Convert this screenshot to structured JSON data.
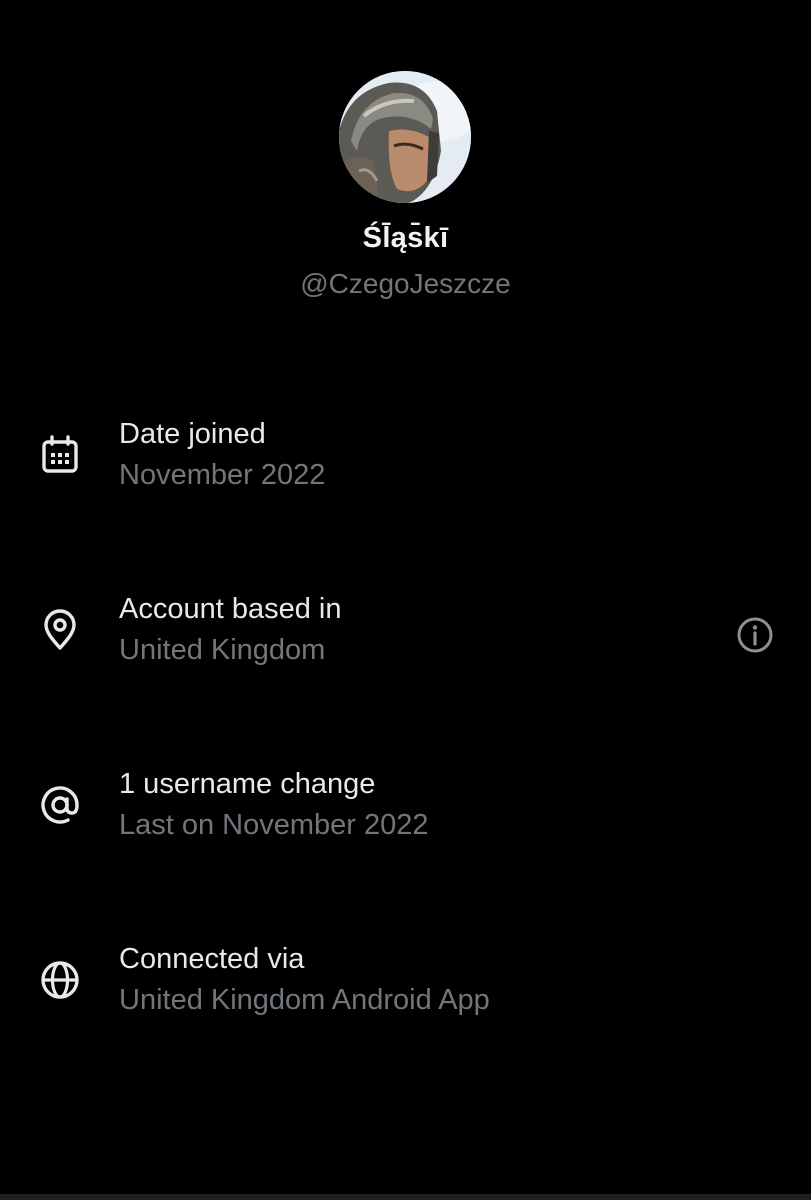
{
  "profile": {
    "display_name": "Śl̄ąs̄kī",
    "handle": "@CzegoJeszcze"
  },
  "rows": [
    {
      "icon": "calendar-icon",
      "title": "Date joined",
      "value": "November 2022"
    },
    {
      "icon": "location-pin-icon",
      "title": "Account based in",
      "value": "United Kingdom",
      "action_icon": "info-icon"
    },
    {
      "icon": "at-sign-icon",
      "title": "1 username change",
      "value": "Last on November 2022"
    },
    {
      "icon": "globe-icon",
      "title": "Connected via",
      "value": "United Kingdom Android App"
    }
  ],
  "colors": {
    "background": "#000000",
    "primary_text": "#e7e9ea",
    "secondary_text": "#71767b"
  }
}
